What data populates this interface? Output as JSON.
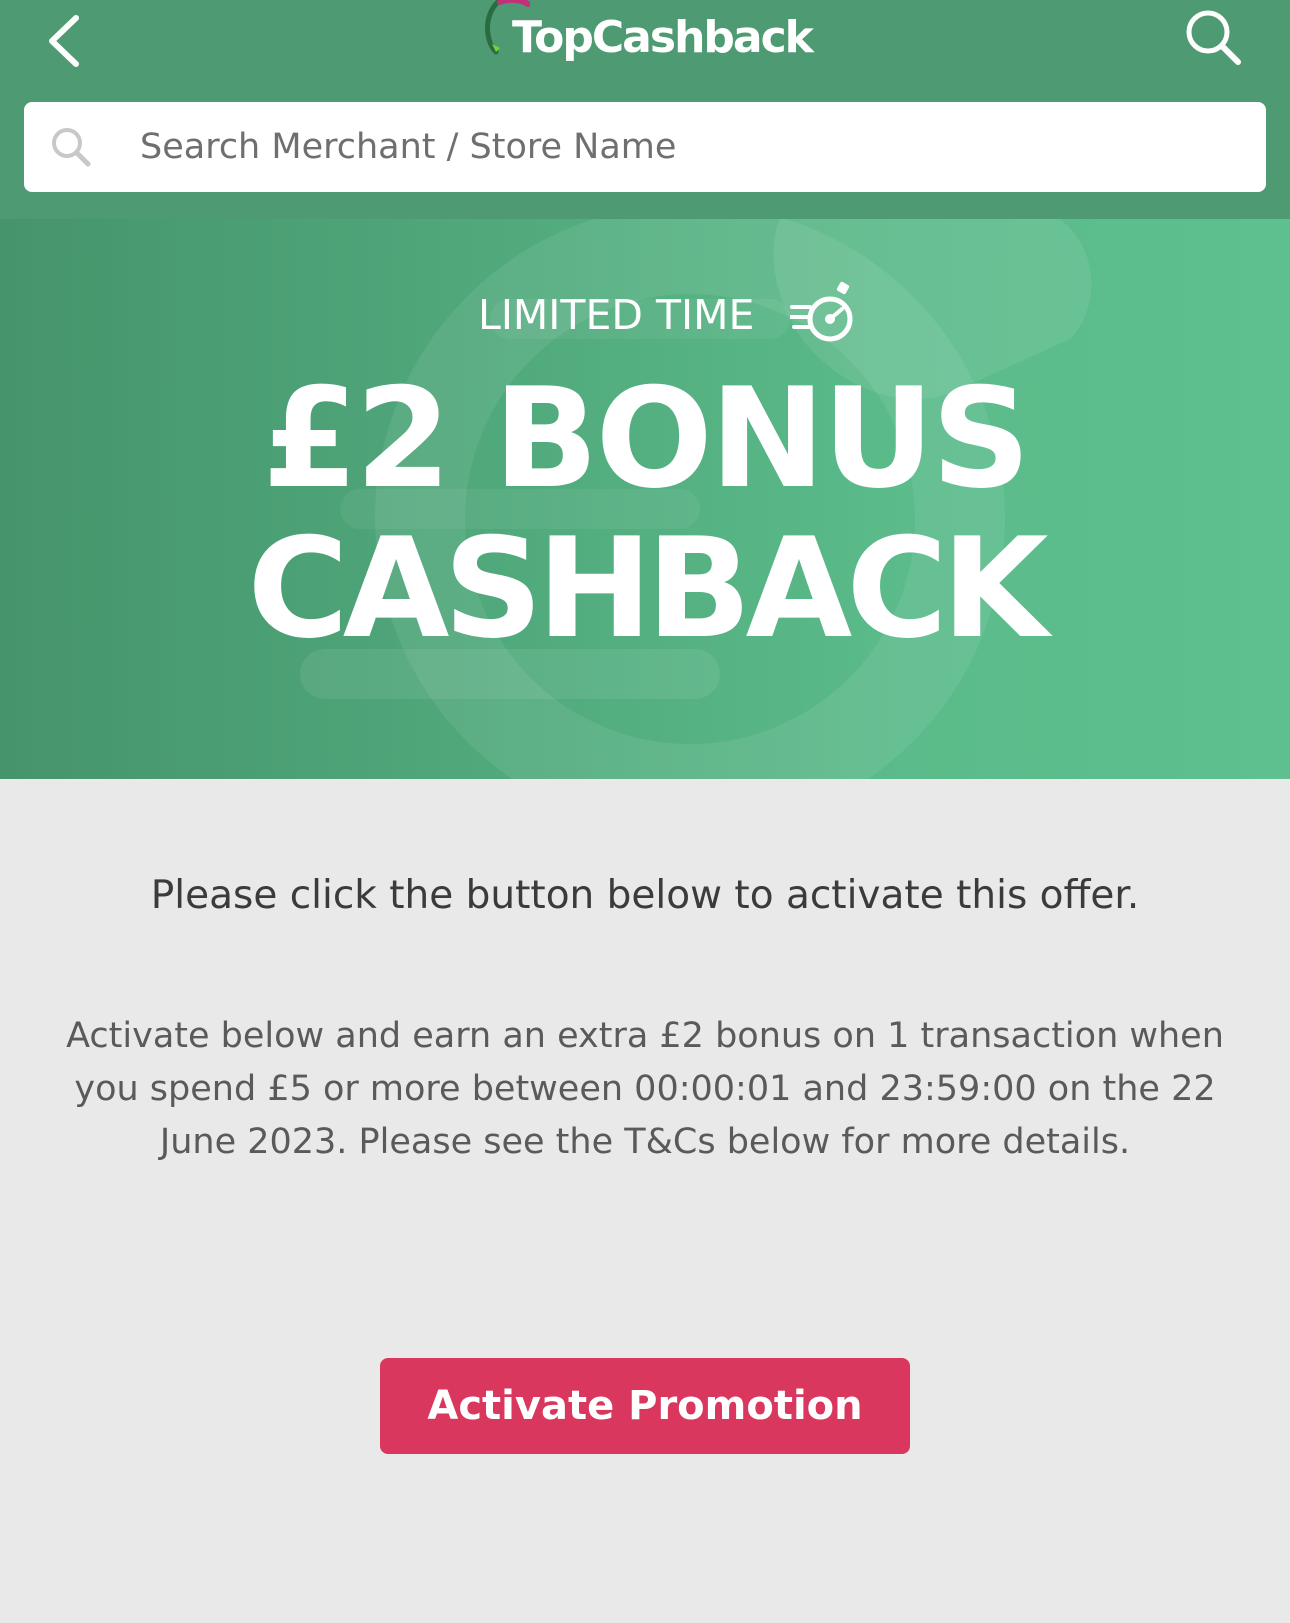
{
  "header": {
    "logo_text": "TopCashback",
    "search": {
      "placeholder": "Search Merchant / Store Name"
    }
  },
  "banner": {
    "limited_label": "LIMITED TIME",
    "headline_line1": "£2 BONUS",
    "headline_line2": "CASHBACK"
  },
  "content": {
    "instruction": "Please click the button below to activate this offer.",
    "details": "Activate below and earn an extra £2 bonus on 1 transaction when you spend £5 or more between 00:00:01 and 23:59:00 on the 22 June 2023. Please see the T&Cs below for more details.",
    "activate_label": "Activate Promotion"
  },
  "icons": {
    "back": "chevron-left-icon",
    "search": "search-icon",
    "timer": "stopwatch-icon"
  },
  "colors": {
    "header_bg": "#4e9a72",
    "banner_green": "#5bbb8a",
    "page_bg": "#e9e9e9",
    "activate_bg": "#d9375d"
  }
}
